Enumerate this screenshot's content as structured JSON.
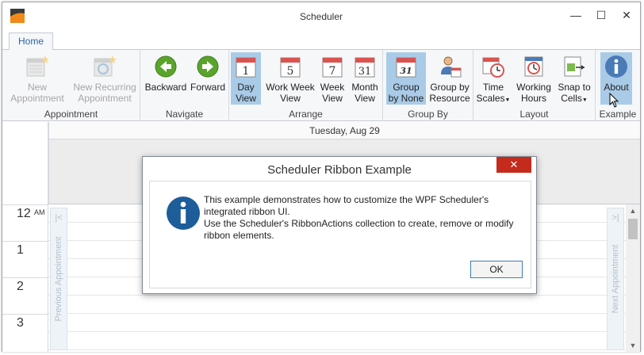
{
  "window": {
    "title": "Scheduler",
    "minimize_glyph": "—",
    "maximize_glyph": "☐",
    "close_glyph": "✕"
  },
  "tabs": [
    {
      "label": "Home",
      "selected": true
    }
  ],
  "ribbon": {
    "groups": [
      {
        "label": "Appointment",
        "items": [
          {
            "line1": "New",
            "line2": "Appointment",
            "enabled": false,
            "icon": "new-appointment-icon"
          },
          {
            "line1": "New Recurring",
            "line2": "Appointment",
            "enabled": false,
            "icon": "new-recurring-appointment-icon"
          }
        ]
      },
      {
        "label": "Navigate",
        "items": [
          {
            "line1": "Backward",
            "line2": "",
            "enabled": true,
            "icon": "backward-arrow-icon"
          },
          {
            "line1": "Forward",
            "line2": "",
            "enabled": true,
            "icon": "forward-arrow-icon"
          }
        ]
      },
      {
        "label": "Arrange",
        "items": [
          {
            "line1": "Day",
            "line2": "View",
            "enabled": true,
            "active": true,
            "icon": "calendar-day-icon",
            "badge": "1"
          },
          {
            "line1": "Work Week",
            "line2": "View",
            "enabled": true,
            "icon": "calendar-work-week-icon",
            "badge": "5"
          },
          {
            "line1": "Week",
            "line2": "View",
            "enabled": true,
            "icon": "calendar-week-icon",
            "badge": "7"
          },
          {
            "line1": "Month",
            "line2": "View",
            "enabled": true,
            "icon": "calendar-month-icon",
            "badge": "31"
          }
        ]
      },
      {
        "label": "Group By",
        "items": [
          {
            "line1": "Group",
            "line2": "by None",
            "enabled": true,
            "active": true,
            "icon": "calendar-group-none-icon",
            "badge": "31"
          },
          {
            "line1": "Group by",
            "line2": "Resource",
            "enabled": true,
            "icon": "group-by-resource-icon"
          }
        ]
      },
      {
        "label": "Layout",
        "items": [
          {
            "line1": "Time",
            "line2": "Scales",
            "enabled": true,
            "icon": "time-scales-icon",
            "dropdown": true
          },
          {
            "line1": "Working",
            "line2": "Hours",
            "enabled": true,
            "icon": "working-hours-icon"
          },
          {
            "line1": "Snap to",
            "line2": "Cells",
            "enabled": true,
            "icon": "snap-to-cells-icon",
            "dropdown": true
          }
        ]
      },
      {
        "label": "Example",
        "items": [
          {
            "line1": "About",
            "line2": "",
            "enabled": true,
            "active": true,
            "icon": "info-icon"
          }
        ]
      }
    ]
  },
  "scheduler": {
    "date_header": "Tuesday, Aug 29",
    "hours": [
      {
        "num": "12",
        "ampm": "AM"
      },
      {
        "num": "1",
        "ampm": ""
      },
      {
        "num": "2",
        "ampm": ""
      },
      {
        "num": "3",
        "ampm": ""
      }
    ],
    "prev_appointment": "Previous Appointment",
    "next_appointment": "Next Appointment",
    "prev_arrow": "|<",
    "next_arrow": ">|"
  },
  "dialog": {
    "title": "Scheduler Ribbon Example",
    "close_glyph": "✕",
    "lines": [
      "This example demonstrates how to customize the WPF Scheduler's",
      "integrated ribbon UI.",
      "Use the Scheduler's RibbonActions collection to create, remove or modify",
      "ribbon elements."
    ],
    "ok_label": "OK"
  },
  "colors": {
    "accent": "#2a64a8",
    "active_button": "#a9cbe8",
    "close_red": "#c42b1c",
    "info_blue": "#1c5d9a",
    "arrow_green": "#5aa42c"
  }
}
